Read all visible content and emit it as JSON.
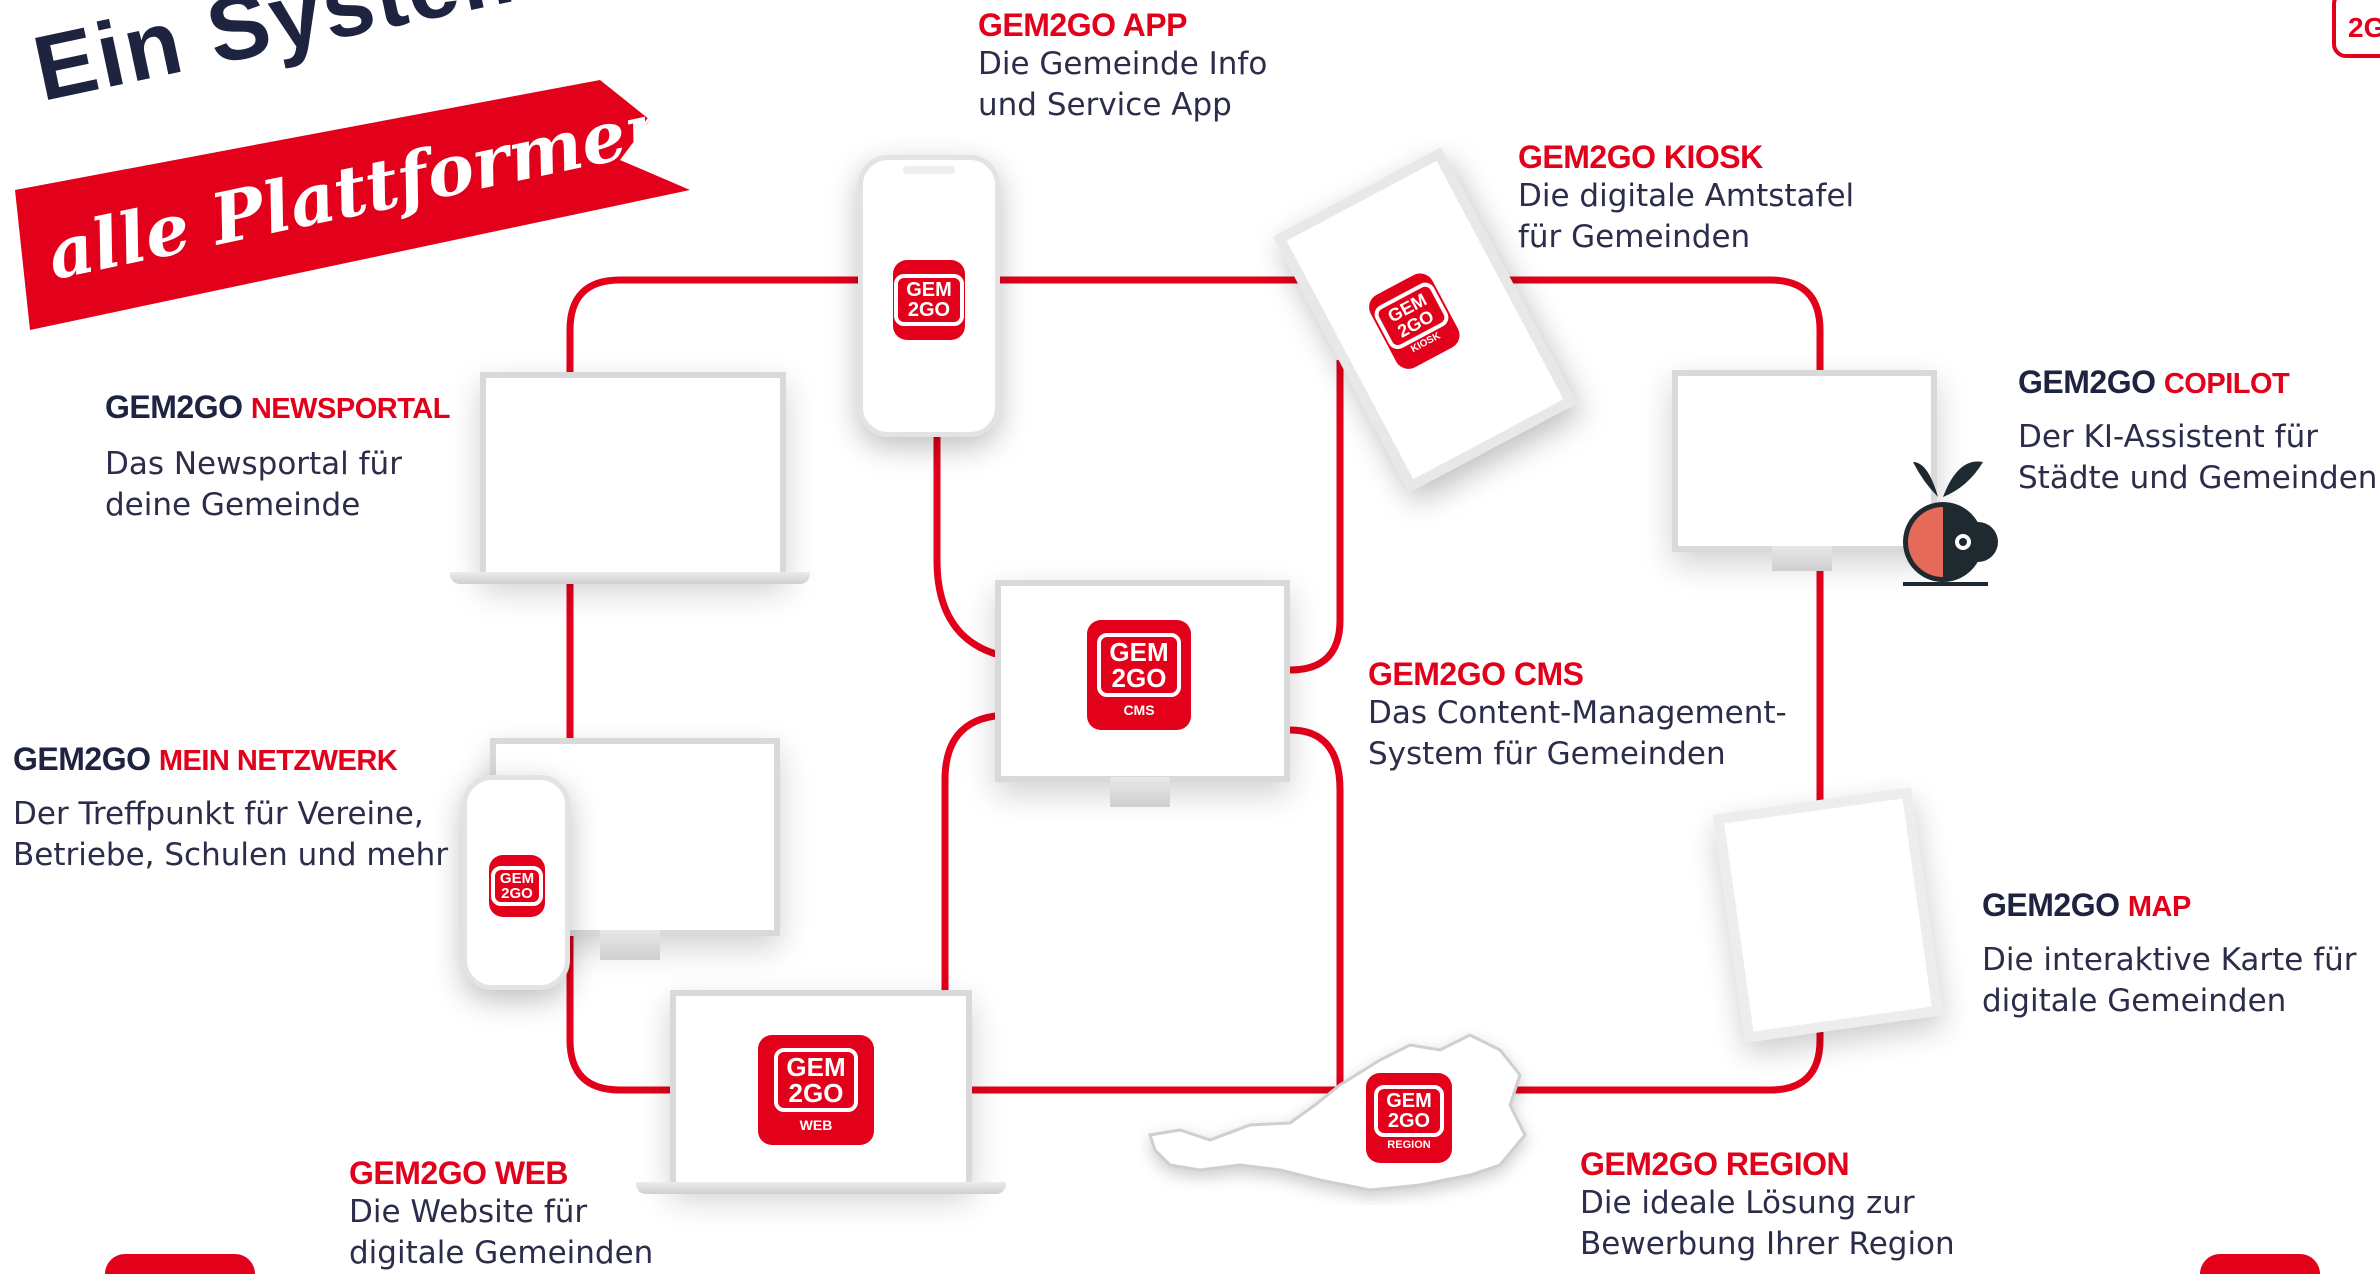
{
  "hero": {
    "line1": "Ein System",
    "line2": "alle Plattformen!"
  },
  "products": {
    "app": {
      "brand": "GEM2GO APP",
      "desc1": "Die Gemeinde Info",
      "desc2": "und Service App"
    },
    "kiosk": {
      "brand": "GEM2GO KIOSK",
      "desc1": "Die digitale Amtstafel",
      "desc2": "für Gemeinden"
    },
    "copilot": {
      "brand": "GEM2GO",
      "suffix": "COPILOT",
      "desc1": "Der KI-Assistent für",
      "desc2": "Städte und Gemeinden"
    },
    "newsportal": {
      "brand": "GEM2GO",
      "suffix": "NEWSPORTAL",
      "desc1": "Das Newsportal für",
      "desc2": "deine Gemeinde"
    },
    "cms": {
      "brand": "GEM2GO CMS",
      "desc1": "Das Content-Management-",
      "desc2": "System für Gemeinden"
    },
    "netzwerk": {
      "brand": "GEM2GO",
      "suffix": "MEIN NETZWERK",
      "desc1": "Der Treffpunkt für Vereine,",
      "desc2": "Betriebe, Schulen und mehr"
    },
    "map": {
      "brand": "GEM2GO",
      "suffix": "MAP",
      "desc1": "Die interaktive Karte für",
      "desc2": "digitale Gemeinden"
    },
    "web": {
      "brand": "GEM2GO WEB",
      "desc1": "Die Website für",
      "desc2": "digitale Gemeinden"
    },
    "region": {
      "brand": "GEM2GO REGION",
      "desc1": "Die ideale Lösung zur",
      "desc2": "Bewerbung Ihrer Region"
    }
  },
  "icons": {
    "gem": "GEM",
    "twogo": "2GO",
    "kiosk_sub": "KIOSK",
    "cms_sub": "CMS",
    "web_sub": "WEB",
    "region_sub": "REGION"
  },
  "corner": {
    "text": "2G"
  },
  "colors": {
    "brand_red": "#e2001a",
    "navy": "#1e2340"
  }
}
